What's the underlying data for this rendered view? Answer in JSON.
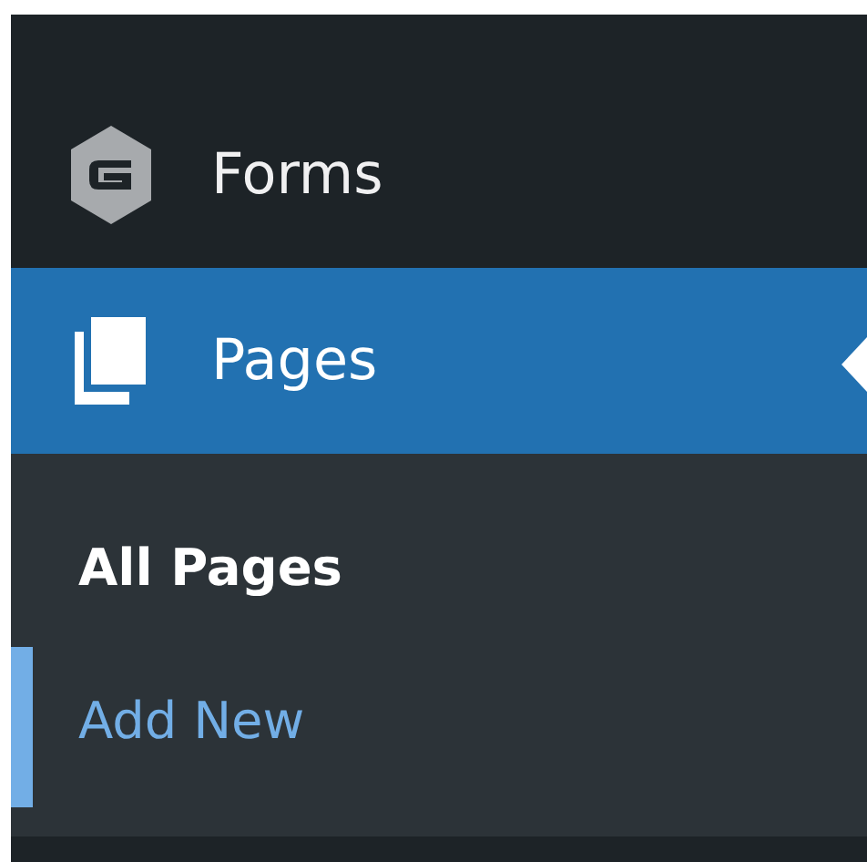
{
  "menu": [
    {
      "label": "Forms",
      "selected": false
    },
    {
      "label": "Pages",
      "selected": true,
      "submenu": [
        {
          "label": "All Pages",
          "selected": true,
          "hovered": false
        },
        {
          "label": "Add New",
          "selected": false,
          "hovered": true
        }
      ]
    }
  ]
}
